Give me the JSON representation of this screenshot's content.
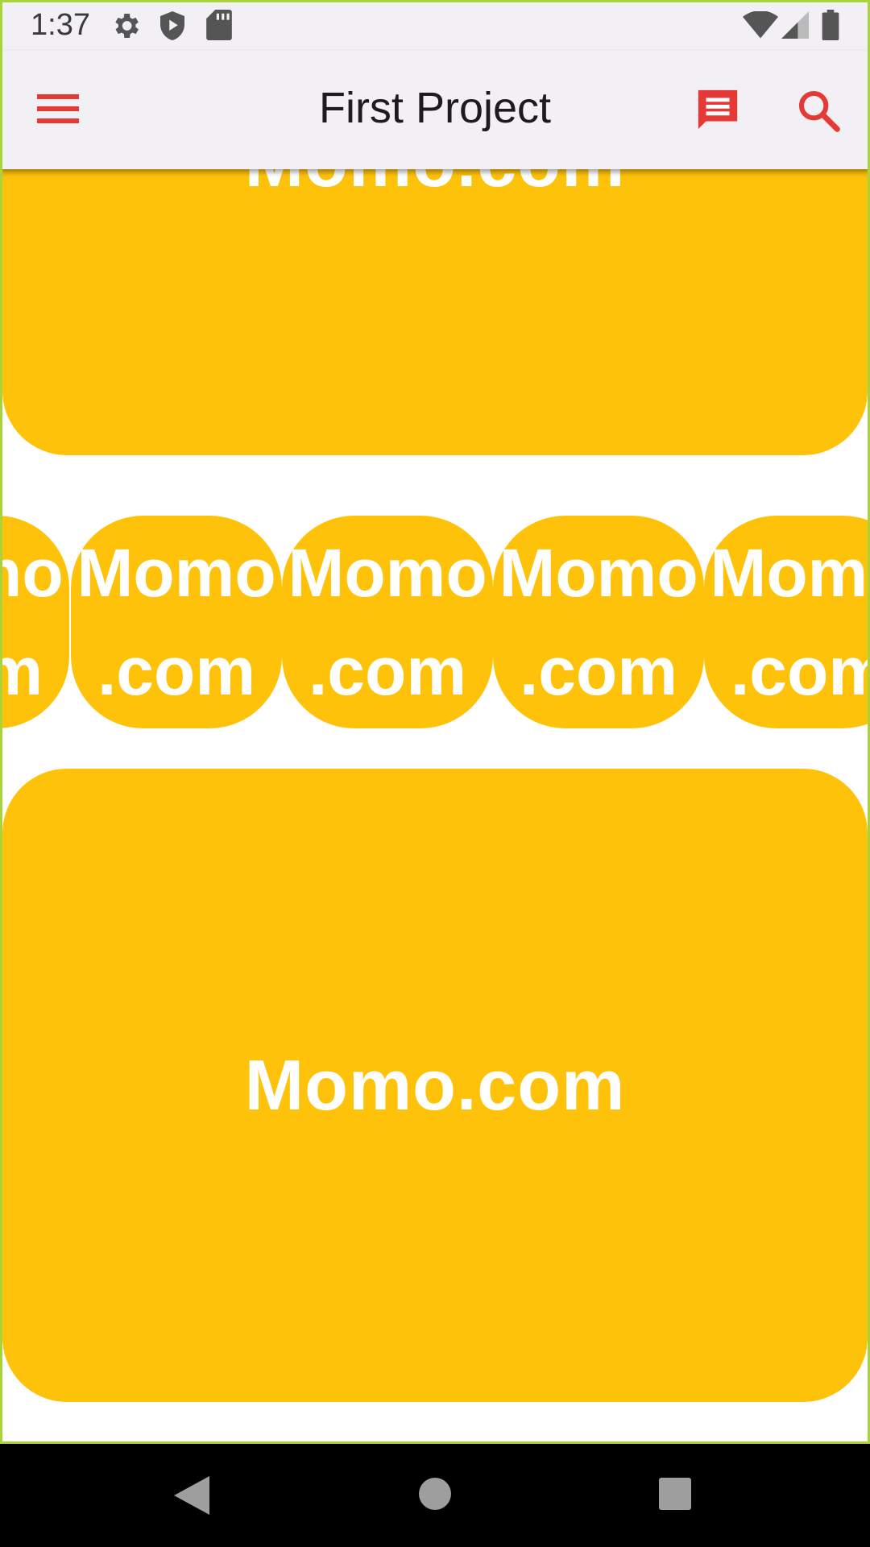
{
  "status_bar": {
    "time": "1:37",
    "left_icons": [
      "settings-icon",
      "shield-play-icon",
      "sd-card-icon"
    ],
    "right_icons": [
      "wifi-icon",
      "cellular-signal-icon",
      "battery-icon"
    ]
  },
  "app_bar": {
    "title": "First Project",
    "menu_icon": "menu-icon",
    "chat_icon": "chat-icon",
    "search_icon": "search-icon",
    "accent_color": "#e53935",
    "background": "#f2eff5"
  },
  "cards": {
    "top_label": "Momo.com",
    "bottom_label": "Momo.com",
    "color": "#ffc20a",
    "text_color": "#ffffff"
  },
  "chips": [
    {
      "line1": "Momo",
      "line2": ".com"
    },
    {
      "line1": "Momo",
      "line2": ".com"
    },
    {
      "line1": "Momo",
      "line2": ".com"
    },
    {
      "line1": "Momo",
      "line2": ".com"
    },
    {
      "line1": "Momo",
      "line2": ".com"
    }
  ],
  "nav_bar": {
    "back_icon": "back-triangle-icon",
    "home_icon": "home-circle-icon",
    "recents_icon": "recents-square-icon"
  }
}
